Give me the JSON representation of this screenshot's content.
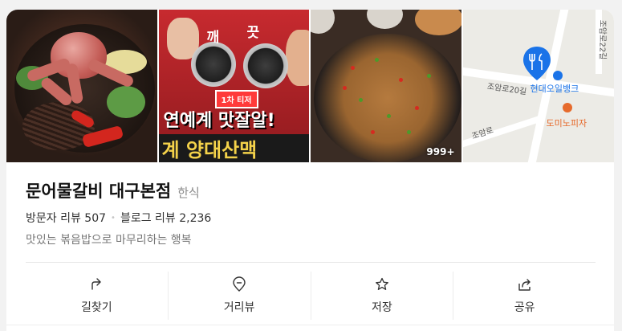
{
  "place": {
    "name": "문어물갈비 대구본점",
    "category": "한식",
    "visitor_reviews": "방문자 리뷰 507",
    "blog_reviews": "블로그 리뷰 2,236",
    "tagline": "맛있는 볶음밥으로 마무리하는 행복"
  },
  "photos": {
    "thumb2_text1": "깨",
    "thumb2_text2": "끗",
    "thumb2_badge": "1차 티저",
    "thumb2_line1": "연예계 맛잘알!",
    "thumb2_line2": "계 양대산맥",
    "photo_count": "999+"
  },
  "map": {
    "road_label_1": "조암로20길",
    "road_label_2": "조암로",
    "road_label_3": "조암로22길",
    "poi_bank": "현대오일뱅크",
    "poi_pizza": "도미노피자",
    "pin_color": "#1a73e8",
    "bank_color": "#1a73e8",
    "pizza_color": "#e66a2c"
  },
  "actions": [
    {
      "label": "길찾기",
      "icon": "directions-icon"
    },
    {
      "label": "거리뷰",
      "icon": "location-pin-icon"
    },
    {
      "label": "저장",
      "icon": "star-icon"
    },
    {
      "label": "공유",
      "icon": "share-icon"
    }
  ]
}
